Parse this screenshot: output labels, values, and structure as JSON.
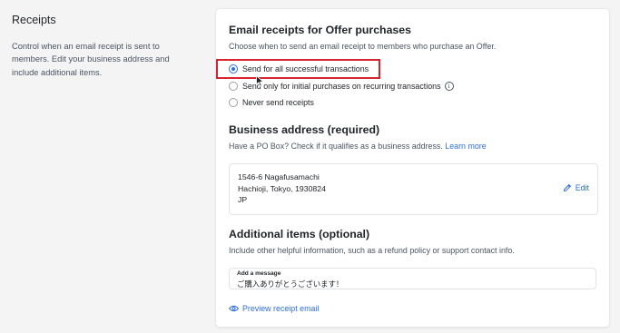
{
  "section": {
    "title": "Receipts",
    "description": "Control when an email receipt is sent to members. Edit your business address and include additional items."
  },
  "email_receipts": {
    "heading": "Email receipts for Offer purchases",
    "description": "Choose when to send an email receipt to members who purchase an Offer.",
    "options": [
      {
        "label": "Send for all successful transactions",
        "selected": true
      },
      {
        "label": "Send only for initial purchases on recurring transactions",
        "selected": false
      },
      {
        "label": "Never send receipts",
        "selected": false
      }
    ],
    "info_icon": "info-icon"
  },
  "business_address": {
    "heading": "Business address (required)",
    "description": "Have a PO Box? Check if it qualifies as a business address.",
    "learn_more": "Learn more",
    "lines": [
      "1546-6 Nagafusamachi",
      "Hachioji, Tokyo, 1930824",
      "JP"
    ],
    "edit_label": "Edit"
  },
  "additional_items": {
    "heading": "Additional items (optional)",
    "description": "Include other helpful information, such as a refund policy or support contact info.",
    "message_label": "Add a message",
    "message_value": "ご購入ありがとうございます！",
    "preview_label": "Preview receipt email"
  },
  "colors": {
    "accent": "#2f6fda",
    "highlight": "#d9232e"
  }
}
